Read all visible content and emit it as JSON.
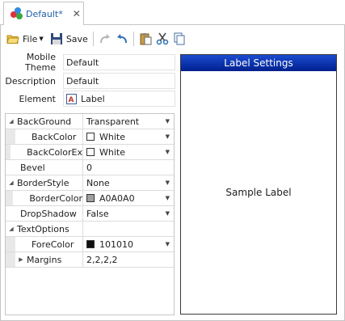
{
  "tab": {
    "title": "Default*",
    "close_glyph": "✕",
    "icon": "app-logo-icon"
  },
  "toolbar": {
    "file_label": "File",
    "save_label": "Save",
    "icons": [
      "open-folder-icon",
      "save-icon",
      "redo-icon",
      "undo-icon",
      "paste-icon",
      "cut-icon",
      "copy-icon"
    ]
  },
  "form": {
    "mobile_theme_label": "Mobile Theme",
    "mobile_theme_value": "Default",
    "description_label": "Description",
    "description_value": "Default",
    "element_label": "Element",
    "element_value": "Label",
    "element_icon": "label-element-icon"
  },
  "properties": [
    {
      "name": "BackGround",
      "value": "Transparent",
      "expander": "◢",
      "has_dropdown": true
    },
    {
      "name": "BackColor",
      "value": "White",
      "swatch": "#ffffff",
      "has_dropdown": true
    },
    {
      "name": "BackColorEx",
      "value": "White",
      "swatch": "#ffffff",
      "has_dropdown": true
    },
    {
      "name": "Bevel",
      "value": "0"
    },
    {
      "name": "BorderStyle",
      "value": "None",
      "expander": "◢",
      "has_dropdown": true
    },
    {
      "name": "BorderColor",
      "value": "A0A0A0",
      "swatch": "#a0a0a0",
      "has_dropdown": true
    },
    {
      "name": "DropShadow",
      "value": "False",
      "has_dropdown": true
    },
    {
      "name": "TextOptions",
      "value": "",
      "expander": "◢"
    },
    {
      "name": "ForeColor",
      "value": "101010",
      "swatch": "#101010",
      "has_dropdown": true
    },
    {
      "name": "Margins",
      "value": "2,2,2,2",
      "expander": "▶"
    }
  ],
  "preview": {
    "header": "Label Settings",
    "sample_text": "Sample Label"
  },
  "colors": {
    "accent_text": "#1f5fa8",
    "header_top": "#1b4bd0",
    "header_bottom": "#00208e",
    "grid_indent": "#e8e8e8"
  }
}
